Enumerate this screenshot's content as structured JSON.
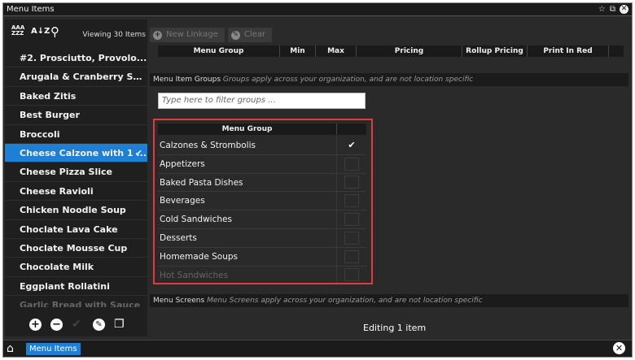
{
  "window": {
    "title": "Menu Items",
    "controls": {
      "pin": "☆",
      "restore": "⧉",
      "close": "✕"
    }
  },
  "left_panel": {
    "toolbar": {
      "sort_alpha": "AAA\nZZZ",
      "sort_asc": "A↓Z",
      "search": "⚲",
      "viewing": "Viewing 30 Items"
    },
    "items": [
      {
        "label": "#2. Prosciutto, Provolo..."
      },
      {
        "label": "Arugala & Cranberry Sa..."
      },
      {
        "label": "Baked Zitis"
      },
      {
        "label": "Best Burger"
      },
      {
        "label": "Broccoli"
      },
      {
        "label": "Cheese Calzone with 1 ..."
      },
      {
        "label": "Cheese Pizza Slice"
      },
      {
        "label": "Cheese Ravioli"
      },
      {
        "label": "Chicken Noodle Soup"
      },
      {
        "label": "Choclate Lava Cake"
      },
      {
        "label": "Choclate Mousse Cup"
      },
      {
        "label": "Chocolate Milk"
      },
      {
        "label": "Eggplant Rollatini"
      },
      {
        "label": "Garlic Bread with Sauce"
      }
    ],
    "selected_index": 5,
    "bottom": {
      "add": "+",
      "remove": "−",
      "check": "✔",
      "edit": "✎",
      "copy": "❐"
    }
  },
  "right_panel": {
    "buttons": {
      "new_linkage": "New Linkage",
      "clear": "Clear"
    },
    "linkage_headers": [
      "Menu Group",
      "Min",
      "Max",
      "Pricing",
      "Rollup Pricing",
      "Print In Red"
    ],
    "groups_section": {
      "title": "Menu Item Groups",
      "note": "Groups apply across your organization, and are not location specific"
    },
    "filter_placeholder": "Type here to filter groups ...",
    "group_table": {
      "header": "Menu Group",
      "rows": [
        {
          "name": "Calzones & Strombolis",
          "checked": true,
          "mark": "✔"
        },
        {
          "name": "Appetizers",
          "checked": false
        },
        {
          "name": "Baked Pasta Dishes",
          "checked": false
        },
        {
          "name": "Beverages",
          "checked": false
        },
        {
          "name": "Cold Sandwiches",
          "checked": false
        },
        {
          "name": "Desserts",
          "checked": false
        },
        {
          "name": "Homemade Soups",
          "checked": false
        },
        {
          "name": "Hot Sandwiches",
          "checked": false
        }
      ]
    },
    "screens_section": {
      "title": "Menu Screens",
      "note": "Menu Screens apply across your organization, and are not location specific"
    },
    "status": "Editing 1 item"
  },
  "taskbar": {
    "home": "⌂",
    "tab": "Menu Items",
    "close": "✕"
  },
  "colors": {
    "accent": "#1e7fd6",
    "highlight_border": "#e23b3b",
    "bg": "#2a2a2a"
  }
}
